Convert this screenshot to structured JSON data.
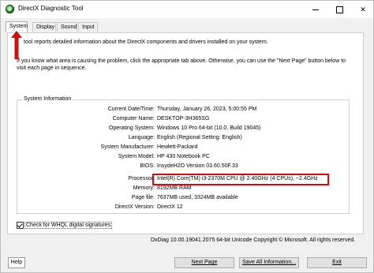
{
  "window": {
    "title": "DirectX Diagnostic Tool",
    "minimize_symbol": "—",
    "maximize_symbol": "☐",
    "close_symbol": "✕"
  },
  "tabs": [
    {
      "label": "System",
      "active": true
    },
    {
      "label": "Display",
      "active": false
    },
    {
      "label": "Sound",
      "active": false
    },
    {
      "label": "Input",
      "active": false
    }
  ],
  "intro": {
    "line1": "tool reports detailed information about the DirectX components and drivers installed on your system.",
    "line2": "If you know what area is causing the problem, click the appropriate tab above.  Otherwise, you can use the \"Next Page\" button below to visit each page in sequence."
  },
  "system_info": {
    "legend": "System Information",
    "rows": [
      {
        "label": "Current Date/Time:",
        "value": "Thursday, January 26, 2023, 5:00:55 PM"
      },
      {
        "label": "Computer Name:",
        "value": "DESKTOP-3H365SG"
      },
      {
        "label": "Operating System:",
        "value": "Windows 10 Pro 64-bit (10.0, Build 19045)"
      },
      {
        "label": "Language:",
        "value": "English (Regional Setting: English)"
      },
      {
        "label": "System Manufacturer:",
        "value": "Hewlett-Packard"
      },
      {
        "label": "System Model:",
        "value": "HP 430 Notebook PC"
      },
      {
        "label": "BIOS:",
        "value": "InsydeH2O Version 03.60.50F.33"
      },
      {
        "label": "Processor:",
        "value": "Intel(R) Core(TM) i3-2370M CPU @ 2.40GHz (4 CPUs), ~2.4GHz"
      },
      {
        "label": "Memory:",
        "value": "8192MB RAM"
      },
      {
        "label": "Page file:",
        "value": "7637MB used, 3324MB available"
      },
      {
        "label": "DirectX Version:",
        "value": "DirectX 12"
      }
    ]
  },
  "whql": {
    "label": "Check for WHQL digital signatures",
    "checked": true
  },
  "footer": {
    "copyright": "DxDiag 10.00.19041.2075 64-bit Unicode  Copyright © Microsoft. All rights reserved."
  },
  "buttons": {
    "help": "Help",
    "next_page": "Next Page",
    "save_all": "Save All Information...",
    "exit": "Exit"
  },
  "colors": {
    "highlight": "#d10d0d",
    "arrow": "#d10d0d"
  }
}
